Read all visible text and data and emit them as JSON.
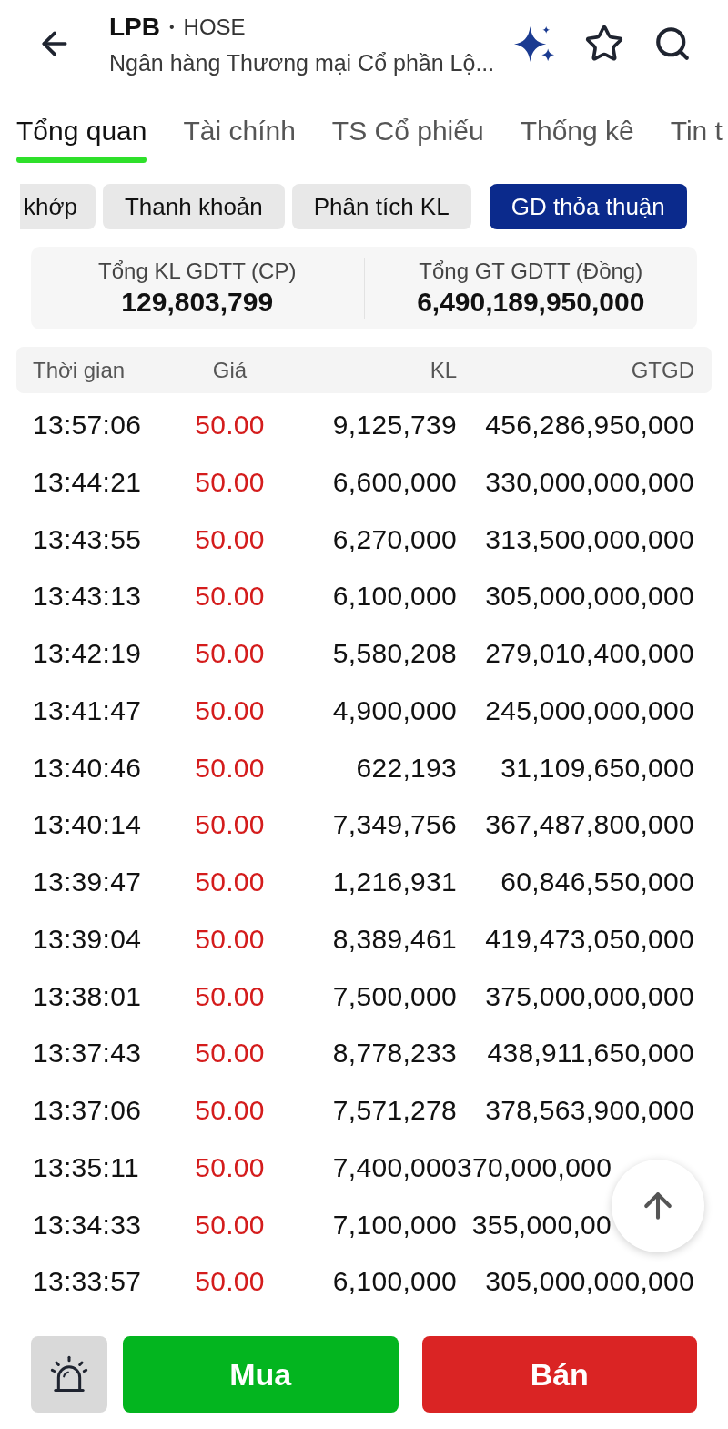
{
  "header": {
    "symbol": "LPB",
    "separator": "•",
    "exchange": "HOSE",
    "company_name": "Ngân hàng Thương mại Cổ phần Lộ..."
  },
  "tabs": [
    {
      "label": "Tổng quan",
      "selected": true
    },
    {
      "label": "Tài chính",
      "selected": false
    },
    {
      "label": "TS Cổ phiếu",
      "selected": false
    },
    {
      "label": "Thống kê",
      "selected": false
    },
    {
      "label": "Tin t",
      "selected": false
    }
  ],
  "sub_tabs": [
    {
      "label": "khớp",
      "selected": false
    },
    {
      "label": "Thanh khoản",
      "selected": false
    },
    {
      "label": "Phân tích KL",
      "selected": false
    },
    {
      "label": "GD thỏa thuận",
      "selected": true
    }
  ],
  "summary": [
    {
      "label": "Tổng KL GDTT (CP)",
      "value": "129,803,799"
    },
    {
      "label": "Tổng GT GDTT (Đồng)",
      "value": "6,490,189,950,000"
    }
  ],
  "table": {
    "columns": [
      "Thời gian",
      "Giá",
      "KL",
      "GTGD"
    ],
    "rows": [
      {
        "time": "13:57:06",
        "price": "50.00",
        "volume": "9,125,739",
        "value": "456,286,950,000"
      },
      {
        "time": "13:44:21",
        "price": "50.00",
        "volume": "6,600,000",
        "value": "330,000,000,000"
      },
      {
        "time": "13:43:55",
        "price": "50.00",
        "volume": "6,270,000",
        "value": "313,500,000,000"
      },
      {
        "time": "13:43:13",
        "price": "50.00",
        "volume": "6,100,000",
        "value": "305,000,000,000"
      },
      {
        "time": "13:42:19",
        "price": "50.00",
        "volume": "5,580,208",
        "value": "279,010,400,000"
      },
      {
        "time": "13:41:47",
        "price": "50.00",
        "volume": "4,900,000",
        "value": "245,000,000,000"
      },
      {
        "time": "13:40:46",
        "price": "50.00",
        "volume": "622,193",
        "value": "31,109,650,000"
      },
      {
        "time": "13:40:14",
        "price": "50.00",
        "volume": "7,349,756",
        "value": "367,487,800,000"
      },
      {
        "time": "13:39:47",
        "price": "50.00",
        "volume": "1,216,931",
        "value": "60,846,550,000"
      },
      {
        "time": "13:39:04",
        "price": "50.00",
        "volume": "8,389,461",
        "value": "419,473,050,000"
      },
      {
        "time": "13:38:01",
        "price": "50.00",
        "volume": "7,500,000",
        "value": "375,000,000,000"
      },
      {
        "time": "13:37:43",
        "price": "50.00",
        "volume": "8,778,233",
        "value": "438,911,650,000"
      },
      {
        "time": "13:37:06",
        "price": "50.00",
        "volume": "7,571,278",
        "value": "378,563,900,000"
      },
      {
        "time": "13:35:11",
        "price": "50.00",
        "volume": "7,400,000",
        "value": "370,000,000"
      },
      {
        "time": "13:34:33",
        "price": "50.00",
        "volume": "7,100,000",
        "value": "355,000,00"
      },
      {
        "time": "13:33:57",
        "price": "50.00",
        "volume": "6,100,000",
        "value": "305,000,000,000"
      }
    ]
  },
  "actions": {
    "buy": "Mua",
    "sell": "Bán"
  }
}
